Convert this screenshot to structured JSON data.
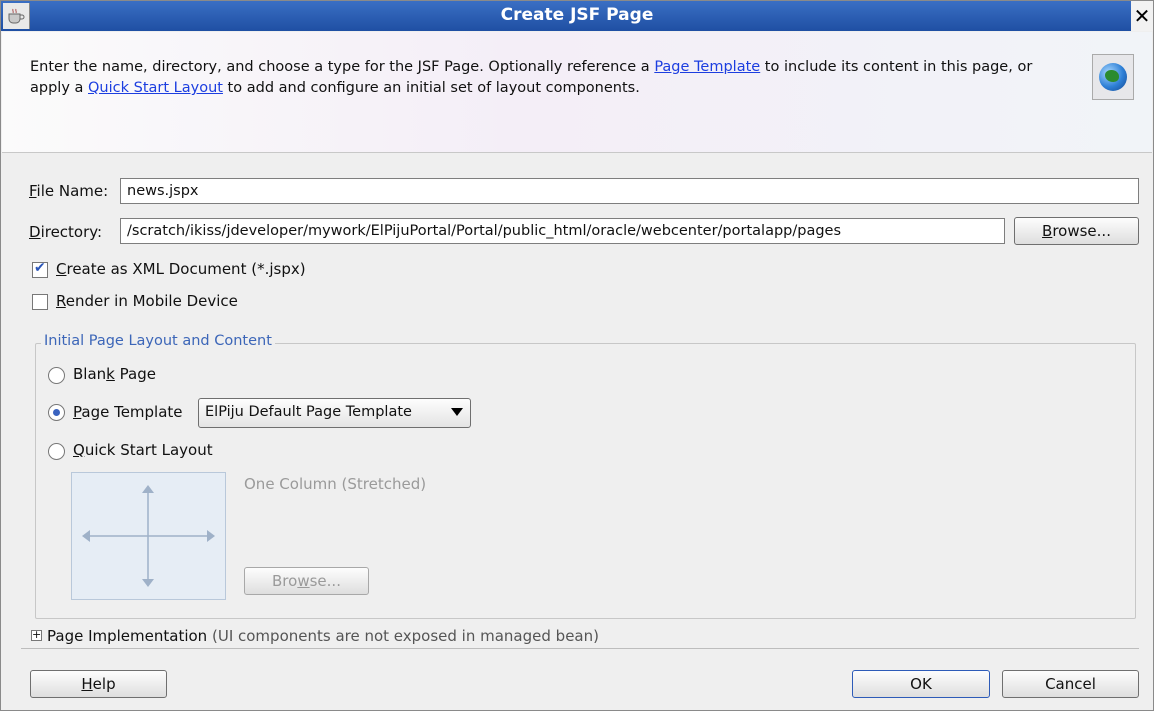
{
  "window": {
    "title": "Create JSF Page",
    "close_glyph": "✕"
  },
  "header": {
    "desc_part1": "Enter the name, directory, and choose a type for the JSF Page. Optionally reference a ",
    "link_page_template": "Page Template",
    "desc_part2": " to include its content in this page, or apply a ",
    "link_quick_start": "Quick Start Layout",
    "desc_part3": " to add and configure an initial set of layout components.",
    "icon": "globe-icon"
  },
  "form": {
    "file_name_label_mnemonic": "F",
    "file_name_label_rest": "ile Name:",
    "file_name_value": "news.jspx",
    "directory_label_mnemonic": "D",
    "directory_label_rest": "irectory:",
    "directory_value": "/scratch/ikiss/jdeveloper/mywork/ElPijuPortal/Portal/public_html/oracle/webcenter/portalapp/pages",
    "browse_mnemonic": "B",
    "browse_rest": "rowse...",
    "create_xml_mnemonic": "C",
    "create_xml_rest": "reate as XML Document (*.jspx)",
    "create_xml_checked": true,
    "render_mobile_mnemonic": "R",
    "render_mobile_rest": "ender in Mobile Device",
    "render_mobile_checked": false
  },
  "layout_group": {
    "title": "Initial Page Layout and Content",
    "blank_page_pre": "Blan",
    "blank_page_mnemonic": "k",
    "blank_page_post": " Page",
    "page_template_mnemonic": "P",
    "page_template_rest": "age Template",
    "page_template_selected": "ElPiju Default Page Template",
    "quick_start_mnemonic": "Q",
    "quick_start_rest": "uick Start Layout",
    "selected_option": "page_template",
    "layout_name": "One Column (Stretched)",
    "browse2_pre": "Bro",
    "browse2_mnemonic": "w",
    "browse2_post": "se..."
  },
  "implementation": {
    "label": "Page Implementation",
    "note": "(UI components are not exposed in managed bean)"
  },
  "footer": {
    "help_mnemonic": "H",
    "help_rest": "elp",
    "ok_label": "OK",
    "cancel_label": "Cancel"
  },
  "colors": {
    "accent": "#2d5bb8",
    "title_bar": "#2a5db0",
    "group_title": "#3c66b8",
    "link": "#1c3ee0"
  }
}
